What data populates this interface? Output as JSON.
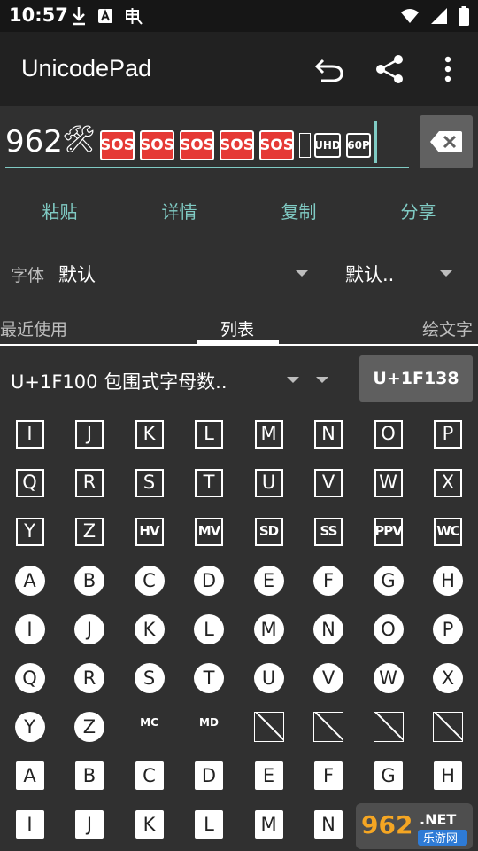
{
  "status": {
    "time": "10:57"
  },
  "app": {
    "title": "UnicodePad"
  },
  "editor": {
    "digits": "962",
    "tool_glyph": "🛠",
    "sos_labels": [
      "SOS",
      "SOS",
      "SOS",
      "SOS",
      "SOS"
    ],
    "uhd_label": "UHD",
    "sixtyp_label": "60P"
  },
  "actions": {
    "paste": "粘贴",
    "details": "详情",
    "copy": "复制",
    "share": "分享"
  },
  "font": {
    "label": "字体",
    "value": "默认",
    "value2": "默认.."
  },
  "tabs": {
    "recent": "最近使用",
    "list": "列表",
    "emoji": "绘文字"
  },
  "block": {
    "label": "U+1F100 包围式字母数..",
    "code_button": "U+1F138"
  },
  "grid": [
    [
      "I",
      "J",
      "K",
      "L",
      "M",
      "N",
      "O",
      "P"
    ],
    [
      "Q",
      "R",
      "S",
      "T",
      "U",
      "V",
      "W",
      "X"
    ],
    [
      "Y",
      "Z",
      "HV",
      "MV",
      "SD",
      "SS",
      "PPV",
      "WC"
    ],
    [
      "A",
      "B",
      "C",
      "D",
      "E",
      "F",
      "G",
      "H"
    ],
    [
      "I",
      "J",
      "K",
      "L",
      "M",
      "N",
      "O",
      "P"
    ],
    [
      "Q",
      "R",
      "S",
      "T",
      "U",
      "V",
      "W",
      "X"
    ],
    [
      "Y",
      "Z",
      "MC",
      "MD",
      "",
      "",
      "",
      ""
    ],
    [
      "A",
      "B",
      "C",
      "D",
      "E",
      "F",
      "G",
      "H"
    ],
    [
      "I",
      "J",
      "K",
      "L",
      "M",
      "N",
      "",
      ""
    ]
  ],
  "watermark": {
    "logo": "962",
    "net": ".NET",
    "sub": "乐游网"
  },
  "colors": {
    "accent": "#80cbc4",
    "sos": "#e53935",
    "background": "#303030",
    "appbar": "#212121"
  }
}
